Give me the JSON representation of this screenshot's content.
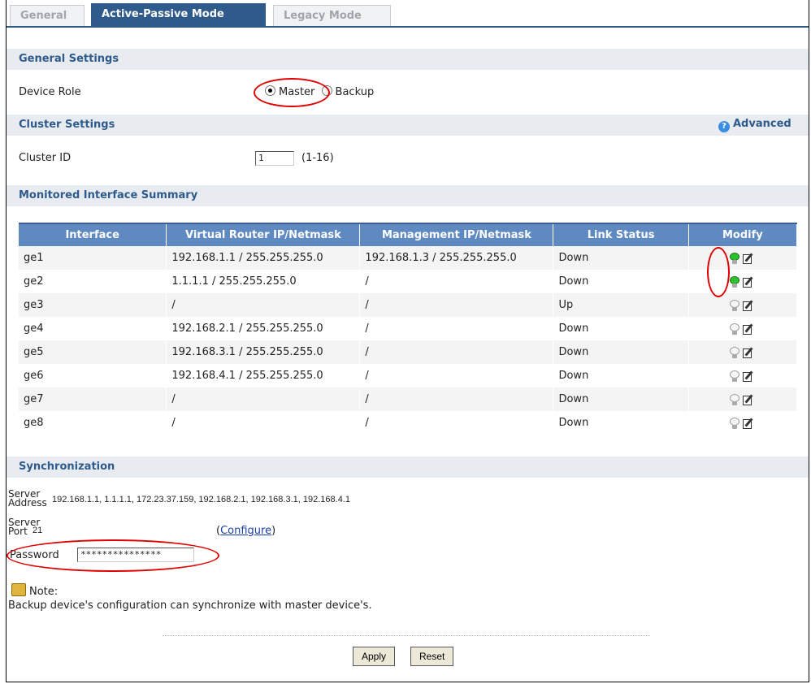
{
  "tabs": [
    {
      "label": "General"
    },
    {
      "label": "Active-Passive Mode"
    },
    {
      "label": "Legacy Mode"
    }
  ],
  "general_settings": {
    "title": "General Settings",
    "device_role_label": "Device Role",
    "role_options": [
      {
        "label": "Master",
        "selected": true
      },
      {
        "label": "Backup",
        "selected": false
      }
    ]
  },
  "cluster_settings": {
    "title": "Cluster Settings",
    "advanced_label": "Advanced",
    "cluster_id_label": "Cluster ID",
    "cluster_id_value": "1",
    "cluster_id_range": "(1-16)"
  },
  "monitored": {
    "title": "Monitored Interface Summary",
    "columns": [
      "Interface",
      "Virtual Router IP/Netmask",
      "Management IP/Netmask",
      "Link Status",
      "Modify"
    ],
    "rows": [
      {
        "interface": "ge1",
        "virtual_ip": "192.168.1.1 / 255.255.255.0",
        "mgmt_ip": "192.168.1.3 / 255.255.255.0",
        "status": "Down",
        "active": true
      },
      {
        "interface": "ge2",
        "virtual_ip": "1.1.1.1 / 255.255.255.0",
        "mgmt_ip": "/",
        "status": "Down",
        "active": true
      },
      {
        "interface": "ge3",
        "virtual_ip": "/",
        "mgmt_ip": "/",
        "status": "Up",
        "active": false
      },
      {
        "interface": "ge4",
        "virtual_ip": "192.168.2.1 / 255.255.255.0",
        "mgmt_ip": "/",
        "status": "Down",
        "active": false
      },
      {
        "interface": "ge5",
        "virtual_ip": "192.168.3.1 / 255.255.255.0",
        "mgmt_ip": "/",
        "status": "Down",
        "active": false
      },
      {
        "interface": "ge6",
        "virtual_ip": "192.168.4.1 / 255.255.255.0",
        "mgmt_ip": "/",
        "status": "Down",
        "active": false
      },
      {
        "interface": "ge7",
        "virtual_ip": "/",
        "mgmt_ip": "/",
        "status": "Down",
        "active": false
      },
      {
        "interface": "ge8",
        "virtual_ip": "/",
        "mgmt_ip": "/",
        "status": "Down",
        "active": false
      }
    ]
  },
  "synchronization": {
    "title": "Synchronization",
    "server_address_label_1": "Server",
    "server_address_label_2": "Address",
    "server_address": "192.168.1.1, 1.1.1.1, 172.23.37.159, 192.168.2.1, 192.168.3.1, 192.168.4.1",
    "server_port_label_1": "Server",
    "server_port_label_2": "Port",
    "server_port": "21",
    "configure_link": "Configure",
    "password_label": "Password",
    "password_value": "***************",
    "note_label": "Note:",
    "note_text": "Backup device's configuration can synchronize with master device's."
  },
  "buttons": {
    "apply": "Apply",
    "reset": "Reset"
  },
  "colors": {
    "accent": "#2e5b8c",
    "header": "#5f8ac1",
    "annotation": "#e00000",
    "bulb_on": "#2ec12e"
  }
}
